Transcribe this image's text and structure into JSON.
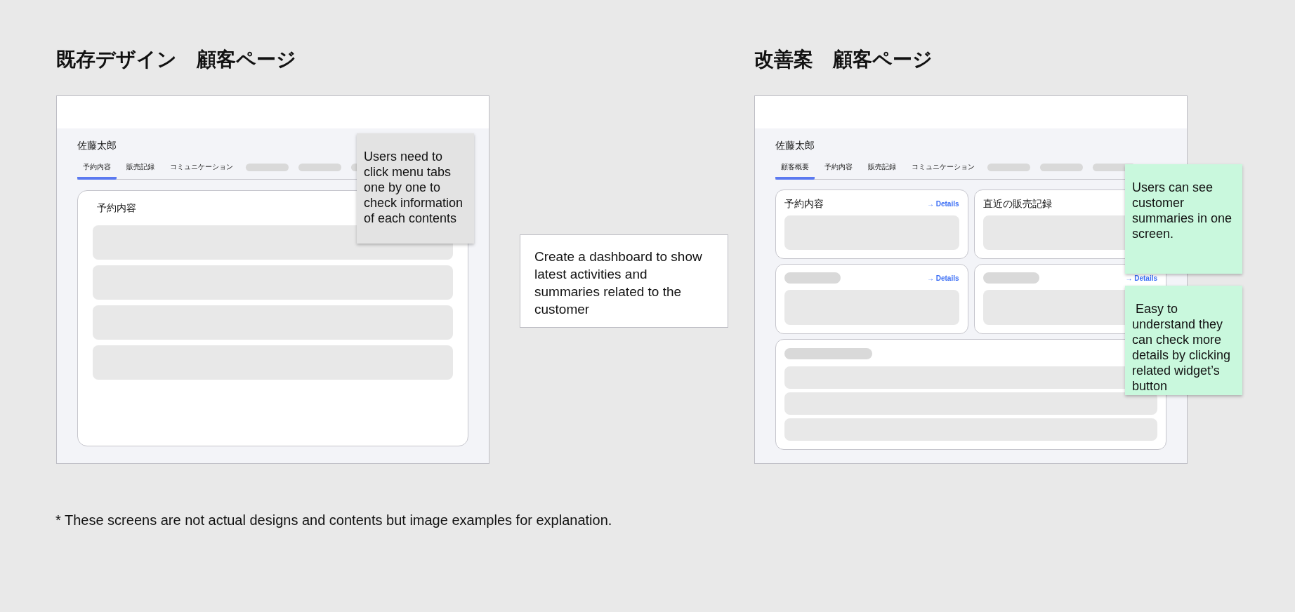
{
  "left": {
    "title": "既存デザイン　顧客ページ",
    "customer_name": "佐藤太郎",
    "tabs": [
      {
        "label": "予約内容",
        "selected": true
      },
      {
        "label": "販売記録",
        "selected": false
      },
      {
        "label": "コミュニケーション",
        "selected": false
      }
    ],
    "panel": {
      "title": "予約内容"
    },
    "note": "Users need to click menu tabs one by one to check information of each contents"
  },
  "middle_note": "Create a dashboard to show latest activities and summaries related to the customer",
  "right": {
    "title": "改善案　顧客ページ",
    "customer_name": "佐藤太郎",
    "tabs": [
      {
        "label": "顧客概要",
        "selected": true
      },
      {
        "label": "予約内容",
        "selected": false
      },
      {
        "label": "販売記録",
        "selected": false
      },
      {
        "label": "コミュニケーション",
        "selected": false
      }
    ],
    "widgets": [
      {
        "title": "予約内容",
        "details": "→ Details"
      },
      {
        "title": "直近の販売記録"
      },
      {
        "details": "→ Details"
      },
      {
        "details": "→ Details"
      }
    ],
    "notes": [
      "Users can see customer summaries in one screen.",
      " Easy to understand they can check more details by clicking related widget’s button"
    ]
  },
  "footnote": "* These screens are not actual designs and contents but image examples for explanation."
}
